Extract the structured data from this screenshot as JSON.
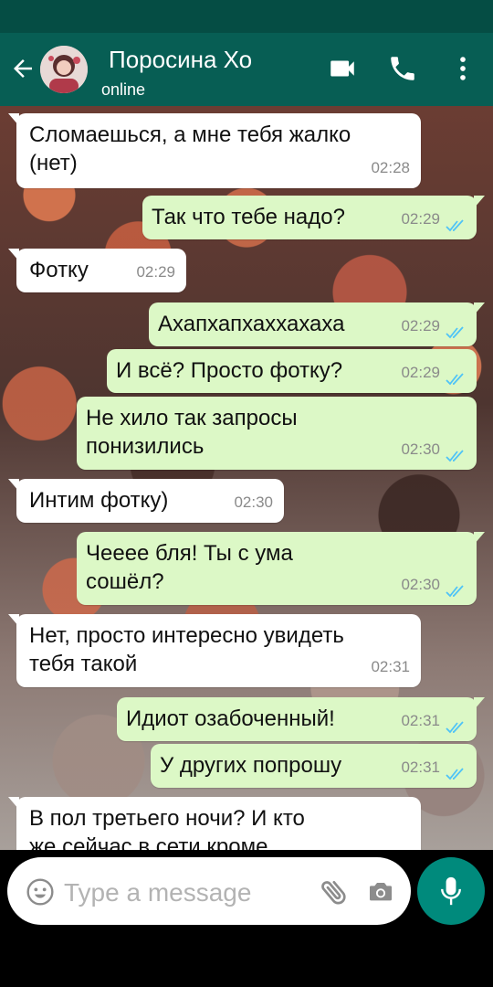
{
  "header": {
    "contact_name": "Поросина Хо",
    "contact_status": "online",
    "back_icon": "arrow-left-icon",
    "video_icon": "video-camera-icon",
    "call_icon": "phone-icon",
    "menu_icon": "more-vertical-icon"
  },
  "messages": [
    {
      "dir": "in",
      "lines": [
        "Сломаешься, а мне тебя жалко",
        "(нет)"
      ],
      "time": "02:28"
    },
    {
      "dir": "out",
      "lines": [
        "Так что тебе надо?"
      ],
      "time": "02:29",
      "read": true
    },
    {
      "dir": "in",
      "lines": [
        "Фотку"
      ],
      "time": "02:29"
    },
    {
      "dir": "out",
      "lines": [
        "Ахапхапхаххахаха"
      ],
      "time": "02:29",
      "read": true
    },
    {
      "dir": "out",
      "lines": [
        "И всё? Просто фотку?"
      ],
      "time": "02:29",
      "read": true
    },
    {
      "dir": "out",
      "lines": [
        "Не хило так запросы",
        "понизились"
      ],
      "time": "02:30",
      "read": true
    },
    {
      "dir": "in",
      "lines": [
        "Интим фотку)"
      ],
      "time": "02:30"
    },
    {
      "dir": "out",
      "lines": [
        "Чееее бля! Ты с ума",
        "сошёл?"
      ],
      "time": "02:30",
      "read": true
    },
    {
      "dir": "in",
      "lines": [
        "Нет, просто интересно увидеть",
        "тебя такой"
      ],
      "time": "02:31"
    },
    {
      "dir": "out",
      "lines": [
        "Идиот озабоченный!"
      ],
      "time": "02:31",
      "read": true
    },
    {
      "dir": "out",
      "lines": [
        "У других попрошу"
      ],
      "time": "02:31",
      "read": true
    },
    {
      "dir": "in",
      "lines": [
        "В пол третьего ночи? И кто",
        "же сейчас в сети кроме"
      ],
      "time": ""
    }
  ],
  "composer": {
    "placeholder": "Type a message",
    "emoji_icon": "emoji-icon",
    "attach_icon": "paperclip-icon",
    "camera_icon": "camera-icon",
    "mic_icon": "microphone-icon"
  },
  "colors": {
    "header": "#075e54",
    "status_bar": "#054d44",
    "outgoing_bubble": "#dcf8c6",
    "incoming_bubble": "#ffffff",
    "read_ticks": "#4fc3f7",
    "mic_button": "#008a7c"
  }
}
